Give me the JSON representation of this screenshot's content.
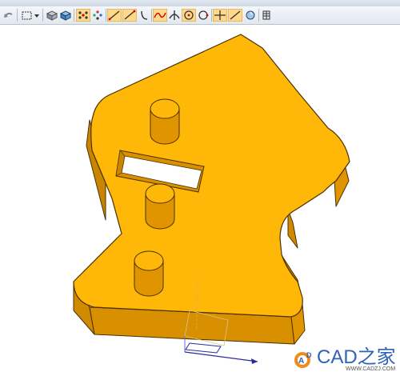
{
  "toolbar": {
    "tools": [
      "undo-icon",
      "select-box-icon",
      "dropdown-icon",
      "shaded-view-icon",
      "cube-icon",
      "snap-point-icon",
      "snap-points-icon",
      "line-icon",
      "polyline-icon",
      "arc-icon",
      "curve-icon",
      "intersect-icon",
      "center-point-icon",
      "circle-point-icon",
      "crosshair-icon",
      "tangent-icon",
      "view-icon",
      "grid-icon"
    ]
  },
  "colors": {
    "part_face": "#FFB807",
    "part_side": "#D88F00",
    "part_edge": "#5A3A00",
    "background": "#FFFFFF"
  },
  "watermark": {
    "brand": "CAD之家",
    "url": "WWW.CADZJ.COM"
  }
}
